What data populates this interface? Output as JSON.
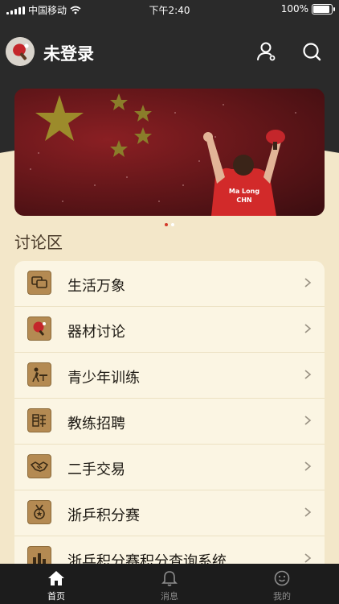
{
  "status_bar": {
    "carrier": "中国移动",
    "time": "下午2:40",
    "battery": "100%"
  },
  "header": {
    "username": "未登录"
  },
  "banner": {
    "jersey_name": "Ma Long",
    "jersey_country": "CHN"
  },
  "section": {
    "title": "讨论区"
  },
  "forums": [
    {
      "label": "生活万象",
      "icon": "chat-bubbles-icon"
    },
    {
      "label": "器材讨论",
      "icon": "ping-pong-paddle-icon"
    },
    {
      "label": "青少年训练",
      "icon": "table-tennis-player-icon"
    },
    {
      "label": "教练招聘",
      "icon": "recruit-icon"
    },
    {
      "label": "二手交易",
      "icon": "handshake-icon"
    },
    {
      "label": "浙乒积分赛",
      "icon": "medal-icon"
    },
    {
      "label": "浙乒积分赛积分查询系统",
      "icon": "bar-chart-icon"
    }
  ],
  "tabs": [
    {
      "label": "首页",
      "icon": "home-icon"
    },
    {
      "label": "消息",
      "icon": "bell-icon"
    },
    {
      "label": "我的",
      "icon": "smile-face-icon"
    }
  ],
  "colors": {
    "accent": "#ffffff",
    "list_bg": "#fbf5e3",
    "page_bg": "#f3e7c9",
    "icon_gold": "#b48a52",
    "dark": "#2a2a2a"
  }
}
